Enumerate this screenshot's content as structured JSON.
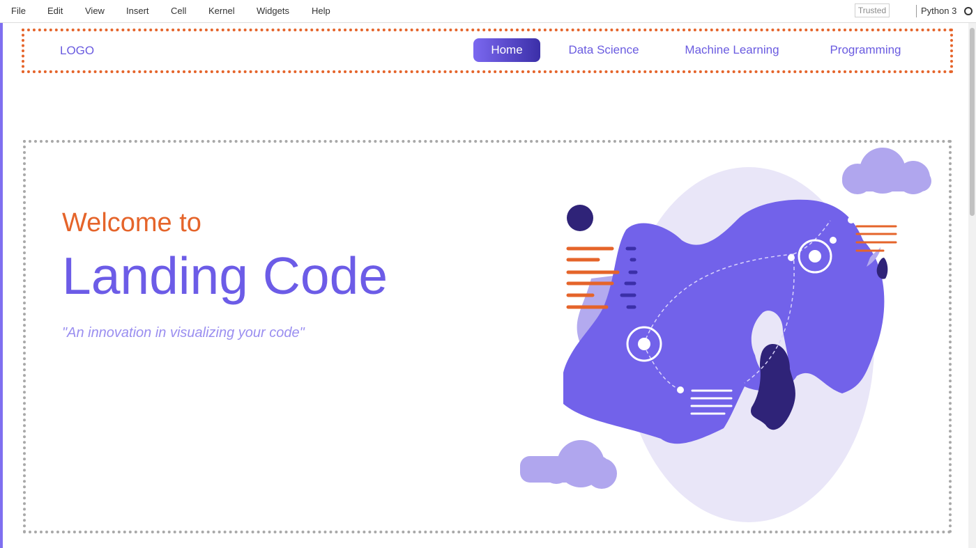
{
  "menubar": {
    "items": [
      "File",
      "Edit",
      "View",
      "Insert",
      "Cell",
      "Kernel",
      "Widgets",
      "Help"
    ],
    "trusted_label": "Trusted",
    "kernel_name": "Python 3"
  },
  "navbar": {
    "logo": "LOGO",
    "links": [
      {
        "label": "Home",
        "active": true
      },
      {
        "label": "Data Science",
        "active": false
      },
      {
        "label": "Machine Learning",
        "active": false
      },
      {
        "label": "Programming",
        "active": false
      }
    ]
  },
  "hero": {
    "welcome": "Welcome to",
    "title": "Landing Code",
    "tagline": "\"An innovation in visualizing your code\""
  },
  "colors": {
    "accent": "#6c5ce7",
    "orange": "#e5642a",
    "dark_purple": "#2f2378",
    "light_purple": "#e9e6f8",
    "cloud": "#b0a6ee"
  },
  "icons": [
    "kernel-status-icon",
    "world-map-illustration",
    "cloud-icon"
  ]
}
